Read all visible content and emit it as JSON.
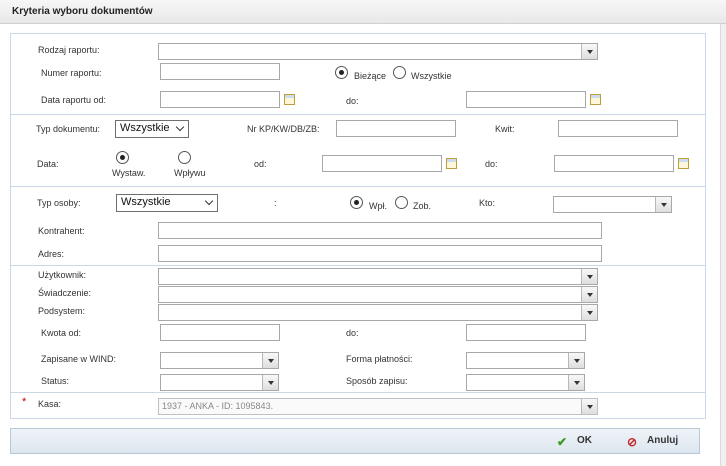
{
  "dialog": {
    "title": "Kryteria wyboru dokumentów"
  },
  "colors": {
    "accent": "#c9d7e6",
    "ok_icon": "#3a9a22",
    "cancel_icon": "#c62828",
    "required": "#c00000"
  },
  "section1": {
    "rodzaj_label": "Rodzaj raportu:",
    "rodzaj_value": "",
    "numer_label": "Numer raportu:",
    "numer_value": "",
    "radio_biezace": "Bieżące",
    "radio_wszystkie": "Wszystkie",
    "data_label": "Data raportu od:",
    "do_label": "do:"
  },
  "section2": {
    "typ_dok_label": "Typ dokumentu:",
    "typ_dok_value": "Wszystkie",
    "nr_label": "Nr KP/KW/DB/ZB:",
    "kwit_label": "Kwit:",
    "data_label": "Data:",
    "radio_wystaw": "Wystaw.",
    "radio_wplywu": "Wpływu",
    "od_label": "od:",
    "do_label": "do:"
  },
  "section3": {
    "typ_osoby_label": "Typ osoby:",
    "typ_osoby_value": "Wszystkie",
    "colon": ":",
    "radio_wpl": "Wpł.",
    "radio_zob": "Zob.",
    "kto_label": "Kto:",
    "kontrahent_label": "Kontrahent:",
    "adres_label": "Adres:"
  },
  "section4": {
    "uzytkownik_label": "Użytkownik:",
    "swiadczenie_label": "Świadczenie:",
    "podsystem_label": "Podsystem:",
    "kwota_label": "Kwota od:",
    "do_label": "do:",
    "zapisane_label": "Zapisane w WIND:",
    "forma_label": "Forma płatności:",
    "status_label": "Status:",
    "sposob_label": "Sposób zapisu:"
  },
  "kasa": {
    "star": "*",
    "label": "Kasa:",
    "value": "1937 - ANKA  - ID: 1095843."
  },
  "footer": {
    "ok_label": "OK",
    "cancel_label": "Anuluj"
  }
}
